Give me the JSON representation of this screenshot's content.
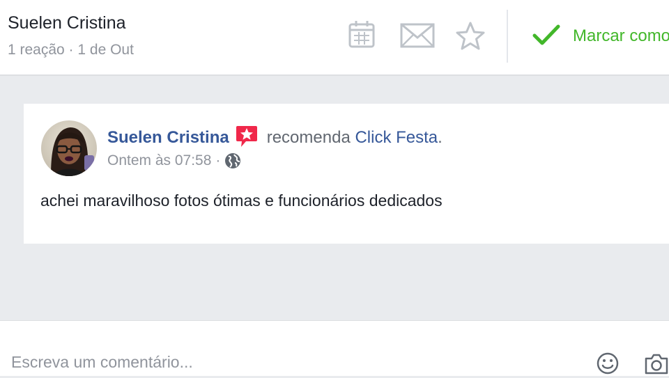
{
  "header": {
    "author_name": "Suelen Cristina",
    "meta": "1 reação · 1 de Out",
    "icons": [
      "calendar-icon",
      "envelope-icon",
      "star-icon"
    ],
    "mark_label": "Marcar como concluído",
    "mark_icon": "checkmark-icon",
    "mark_color": "#42b72a"
  },
  "post": {
    "author": "Suelen Cristina",
    "badge_icon": "recommendation-badge-icon",
    "badge_color": "#f0284a",
    "verb": "recomenda",
    "page": "Click Festa",
    "period": ".",
    "timestamp": "Ontem às 07:58",
    "separator": "·",
    "privacy_icon": "globe-icon",
    "text": "achei maravilhoso fotos ótimas e funcionários dedicados"
  },
  "composer": {
    "placeholder": "Escreva um comentário...",
    "icons": [
      "emoji-icon",
      "camera-icon"
    ]
  },
  "colors": {
    "link_blue": "#365899",
    "muted": "#90949c",
    "page_bg": "#e9ebee"
  }
}
